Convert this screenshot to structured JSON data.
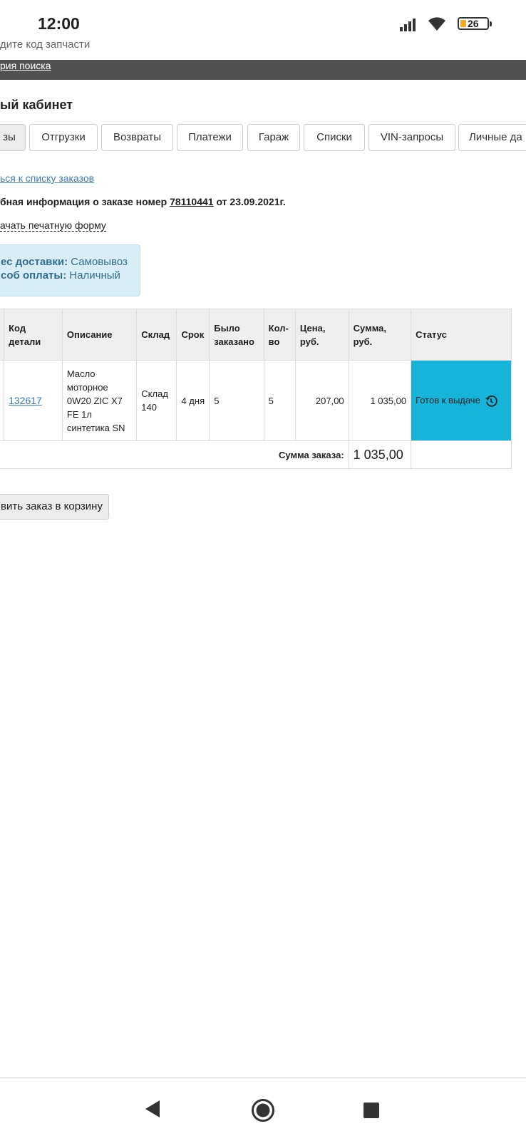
{
  "status_bar": {
    "time": "12:00",
    "battery": "26"
  },
  "browser": {
    "url_hint": "дите код запчасти",
    "history_link": "рия поиска"
  },
  "page": {
    "title": "ый кабинет",
    "tabs": [
      "зы",
      "Отгрузки",
      "Возвраты",
      "Платежи",
      "Гараж",
      "Списки",
      "VIN-запросы",
      "Личные да"
    ],
    "back_link": "ься к списку заказов",
    "order_info_prefix": "бная информация о заказе номер ",
    "order_number": "78110441",
    "order_info_suffix": " от 23.09.2021г.",
    "print_link": "ачать печатную форму"
  },
  "info_box": {
    "delivery_label": "ес доставки:",
    "delivery_value": "Самовывоз",
    "payment_label": "соб оплаты:",
    "payment_value": "Наличный"
  },
  "table": {
    "headers": {
      "code": "Код детали",
      "description": "Описание",
      "warehouse": "Склад",
      "term": "Срок",
      "ordered": "Было заказано",
      "qty": "Кол-во",
      "price": "Цена, руб.",
      "sum": "Сумма, руб.",
      "status": "Статус"
    },
    "rows": [
      {
        "code": "132617",
        "description": "Масло моторное 0W20 ZIC X7 FE 1л синтетика SN",
        "warehouse": "Склад 140",
        "term": "4 дня",
        "ordered": "5",
        "qty": "5",
        "price": "207,00",
        "sum": "1 035,00",
        "status": "Готов к выдаче"
      }
    ],
    "total_label": "Сумма заказа:",
    "total_value": "1 035,00"
  },
  "cart_button": "вить заказ в корзину",
  "colors": {
    "status_ready": "#17b4d9",
    "link": "#3a7fb5",
    "info_bg": "#d9edf7"
  }
}
